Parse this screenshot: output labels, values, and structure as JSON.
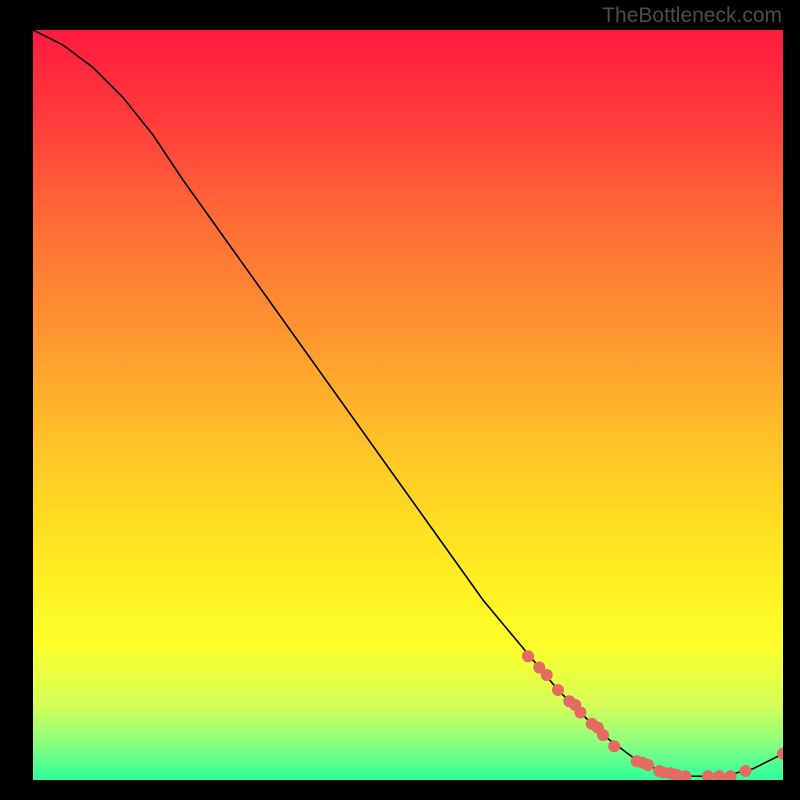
{
  "watermark": "TheBottleneck.com",
  "chart_data": {
    "type": "line",
    "title": "",
    "xlabel": "",
    "ylabel": "",
    "xlim": [
      0,
      100
    ],
    "ylim": [
      0,
      100
    ],
    "background": "vertical-gradient-red-to-green",
    "gradient_stops": [
      {
        "offset": 0.0,
        "color": "#ff1a3f"
      },
      {
        "offset": 0.12,
        "color": "#ff3c3c"
      },
      {
        "offset": 0.25,
        "color": "#ff6a36"
      },
      {
        "offset": 0.4,
        "color": "#ff9430"
      },
      {
        "offset": 0.55,
        "color": "#ffc228"
      },
      {
        "offset": 0.7,
        "color": "#ffe820"
      },
      {
        "offset": 0.82,
        "color": "#fdff2a"
      },
      {
        "offset": 0.9,
        "color": "#d4ff58"
      },
      {
        "offset": 0.95,
        "color": "#8cff7e"
      },
      {
        "offset": 1.0,
        "color": "#2bff9e"
      }
    ],
    "series": [
      {
        "name": "bottleneck-curve",
        "type": "line",
        "color": "#000000",
        "x": [
          0,
          4,
          8,
          12,
          16,
          20,
          25,
          30,
          35,
          40,
          45,
          50,
          55,
          60,
          65,
          70,
          73,
          76,
          80,
          84,
          88,
          92,
          96,
          100
        ],
        "values": [
          100,
          98,
          95,
          91,
          86,
          80,
          73,
          66,
          59,
          52,
          45,
          38,
          31,
          24,
          18,
          12,
          9,
          6,
          3,
          1.0,
          0.5,
          0.5,
          1.5,
          3.5
        ]
      }
    ],
    "scatter_points": {
      "name": "highlighted-points",
      "color": "#e46a62",
      "radius": 6,
      "points": [
        {
          "x": 66.0,
          "y": 16.5
        },
        {
          "x": 67.5,
          "y": 15.0
        },
        {
          "x": 68.5,
          "y": 14.0
        },
        {
          "x": 70.0,
          "y": 12.0
        },
        {
          "x": 71.5,
          "y": 10.5
        },
        {
          "x": 72.3,
          "y": 10.0
        },
        {
          "x": 73.0,
          "y": 9.0
        },
        {
          "x": 74.5,
          "y": 7.5
        },
        {
          "x": 75.3,
          "y": 7.0
        },
        {
          "x": 76.0,
          "y": 6.0
        },
        {
          "x": 77.5,
          "y": 4.5
        },
        {
          "x": 80.5,
          "y": 2.5
        },
        {
          "x": 81.3,
          "y": 2.3
        },
        {
          "x": 82.0,
          "y": 2.0
        },
        {
          "x": 83.5,
          "y": 1.2
        },
        {
          "x": 84.0,
          "y": 1.0
        },
        {
          "x": 85.0,
          "y": 0.9
        },
        {
          "x": 85.8,
          "y": 0.7
        },
        {
          "x": 87.0,
          "y": 0.5
        },
        {
          "x": 90.0,
          "y": 0.5
        },
        {
          "x": 91.5,
          "y": 0.5
        },
        {
          "x": 93.0,
          "y": 0.5
        },
        {
          "x": 95.0,
          "y": 1.2
        },
        {
          "x": 100.0,
          "y": 3.5
        }
      ]
    }
  }
}
